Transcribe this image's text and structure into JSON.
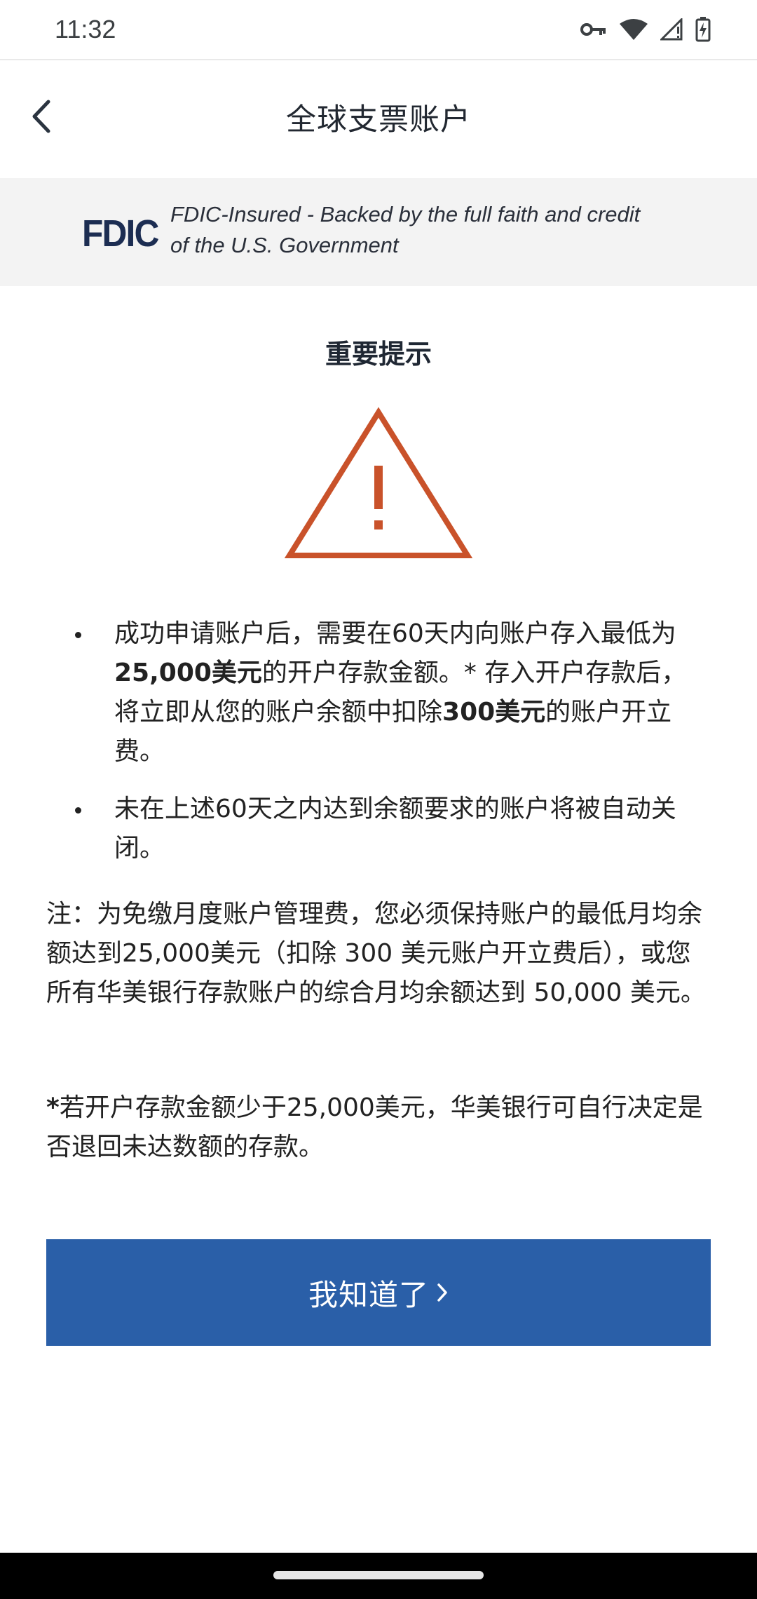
{
  "status_bar": {
    "time": "11:32",
    "icons": [
      "vpn-key-icon",
      "wifi-icon",
      "cellular-signal-icon",
      "battery-charging-icon"
    ]
  },
  "header": {
    "title": "全球支票账户",
    "back_icon": "chevron-left-icon"
  },
  "fdic_banner": {
    "logo_text": "FDIC",
    "text": "FDIC-Insured - Backed by the full faith and credit of the U.S. Government"
  },
  "notice": {
    "heading": "重要提示",
    "icon": "warning-triangle-icon",
    "icon_color": "#c9522a",
    "bullets": [
      {
        "part1": "成功申请账户后，需要在60天内向账户存入最低为",
        "bold1": "25,000美元",
        "part2": "的开户存款金额。* 存入开户存款后，将立即从您的账户余额中扣除",
        "bold2": "300美元",
        "part3": "的账户开立费。"
      },
      {
        "text": "未在上述60天之内达到余额要求的账户将被自动关闭。"
      }
    ],
    "note": "注：为免缴月度账户管理费，您必须保持账户的最低月均余额达到25,000美元（扣除 300 美元账户开立费后），或您所有华美银行存款账户的综合月均余额达到 50,000 美元。",
    "footnote_mark": "*",
    "footnote": "若开户存款金额少于25,000美元，华美银行可自行决定是否退回未达数额的存款。"
  },
  "button": {
    "label": "我知道了",
    "icon": "chevron-right-icon",
    "color": "#2a5fa8"
  }
}
